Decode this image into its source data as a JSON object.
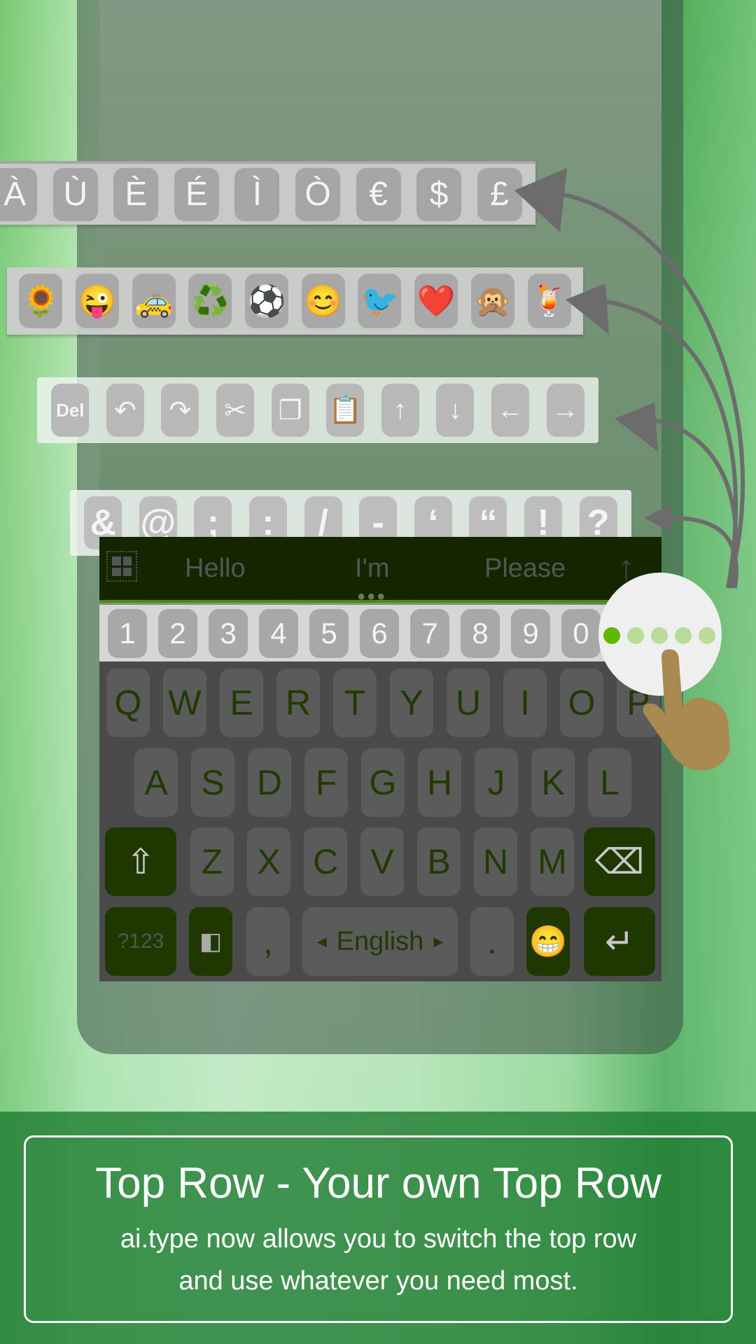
{
  "accent_row": [
    "À",
    "Ù",
    "È",
    "É",
    "Ì",
    "Ò",
    "€",
    "$",
    "£"
  ],
  "emoji_row": [
    "🌻",
    "😜",
    "🚕",
    "♻️",
    "⚽",
    "😊",
    "🐦",
    "❤️",
    "🙊",
    "🍹"
  ],
  "edit_row": {
    "del_label": "Del",
    "icons": [
      "undo-icon",
      "redo-icon",
      "cut-icon",
      "copy-icon",
      "paste-icon",
      "arrow-up-icon",
      "arrow-down-icon",
      "arrow-left-icon",
      "arrow-right-icon"
    ],
    "glyphs": [
      "↶",
      "↷",
      "✂",
      "❐",
      "📋",
      "↑",
      "↓",
      "←",
      "→"
    ]
  },
  "symbol_row": [
    "&",
    "@",
    ";",
    ":",
    "/",
    "-",
    "‘",
    "“",
    "!",
    "?"
  ],
  "suggestions": [
    "Hello",
    "I'm",
    "Please"
  ],
  "number_row": [
    "1",
    "2",
    "3",
    "4",
    "5",
    "6",
    "7",
    "8",
    "9",
    "0"
  ],
  "keyboard": {
    "row1": [
      "Q",
      "W",
      "E",
      "R",
      "T",
      "Y",
      "U",
      "I",
      "O",
      "P"
    ],
    "row2": [
      "A",
      "S",
      "D",
      "F",
      "G",
      "H",
      "J",
      "K",
      "L"
    ],
    "row3": [
      "Z",
      "X",
      "C",
      "V",
      "B",
      "N",
      "M"
    ],
    "symbols_key": "?123",
    "comma": ",",
    "language": "English",
    "period": "."
  },
  "page_indicator": {
    "count": 5,
    "active": 1,
    "active_color": "#5cb800",
    "inactive_color": "#b9dd98"
  },
  "banner": {
    "title": "Top Row - Your own Top Row",
    "subtitle_line1": "ai.type now allows you to switch the top row",
    "subtitle_line2": "and use whatever you need most."
  }
}
